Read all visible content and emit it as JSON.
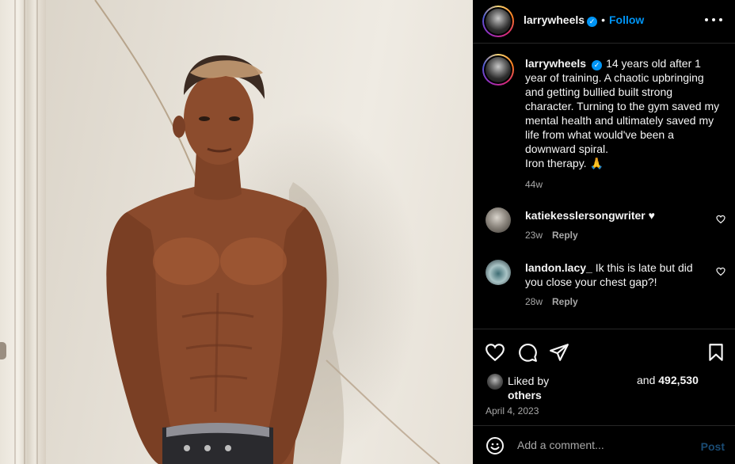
{
  "post": {
    "author": "larrywheels",
    "verified_mark": "✓",
    "separator": "•",
    "follow_label": "Follow",
    "caption": "14 years old after 1 year of training. A chaotic upbringing and getting bullied built strong character. Turning to the gym saved my mental health and ultimately saved my life from what would've been a downward spiral.",
    "caption_tail": "Iron therapy. 🙏",
    "caption_age": "44w",
    "date": "April 4, 2023"
  },
  "comments": [
    {
      "username": "katiekesslersongwriter",
      "text": "♥",
      "age": "23w",
      "reply_label": "Reply"
    },
    {
      "username": "landon.lacy_",
      "text": "Ik this is late but did you close your chest gap?!",
      "age": "28w",
      "reply_label": "Reply"
    }
  ],
  "likes": {
    "prefix": "Liked by",
    "and_label": "and",
    "count": "492,530",
    "others_label": "others"
  },
  "composer": {
    "placeholder": "Add a comment...",
    "post_label": "Post"
  },
  "icons": {
    "more": "more-options-icon",
    "like": "heart-icon",
    "comment": "comment-icon",
    "share": "share-icon",
    "save": "bookmark-icon",
    "emoji": "emoji-icon"
  },
  "colors": {
    "accent": "#0095f6",
    "background": "#000000",
    "secondary_text": "#a8a8a8",
    "divider": "#262626"
  }
}
